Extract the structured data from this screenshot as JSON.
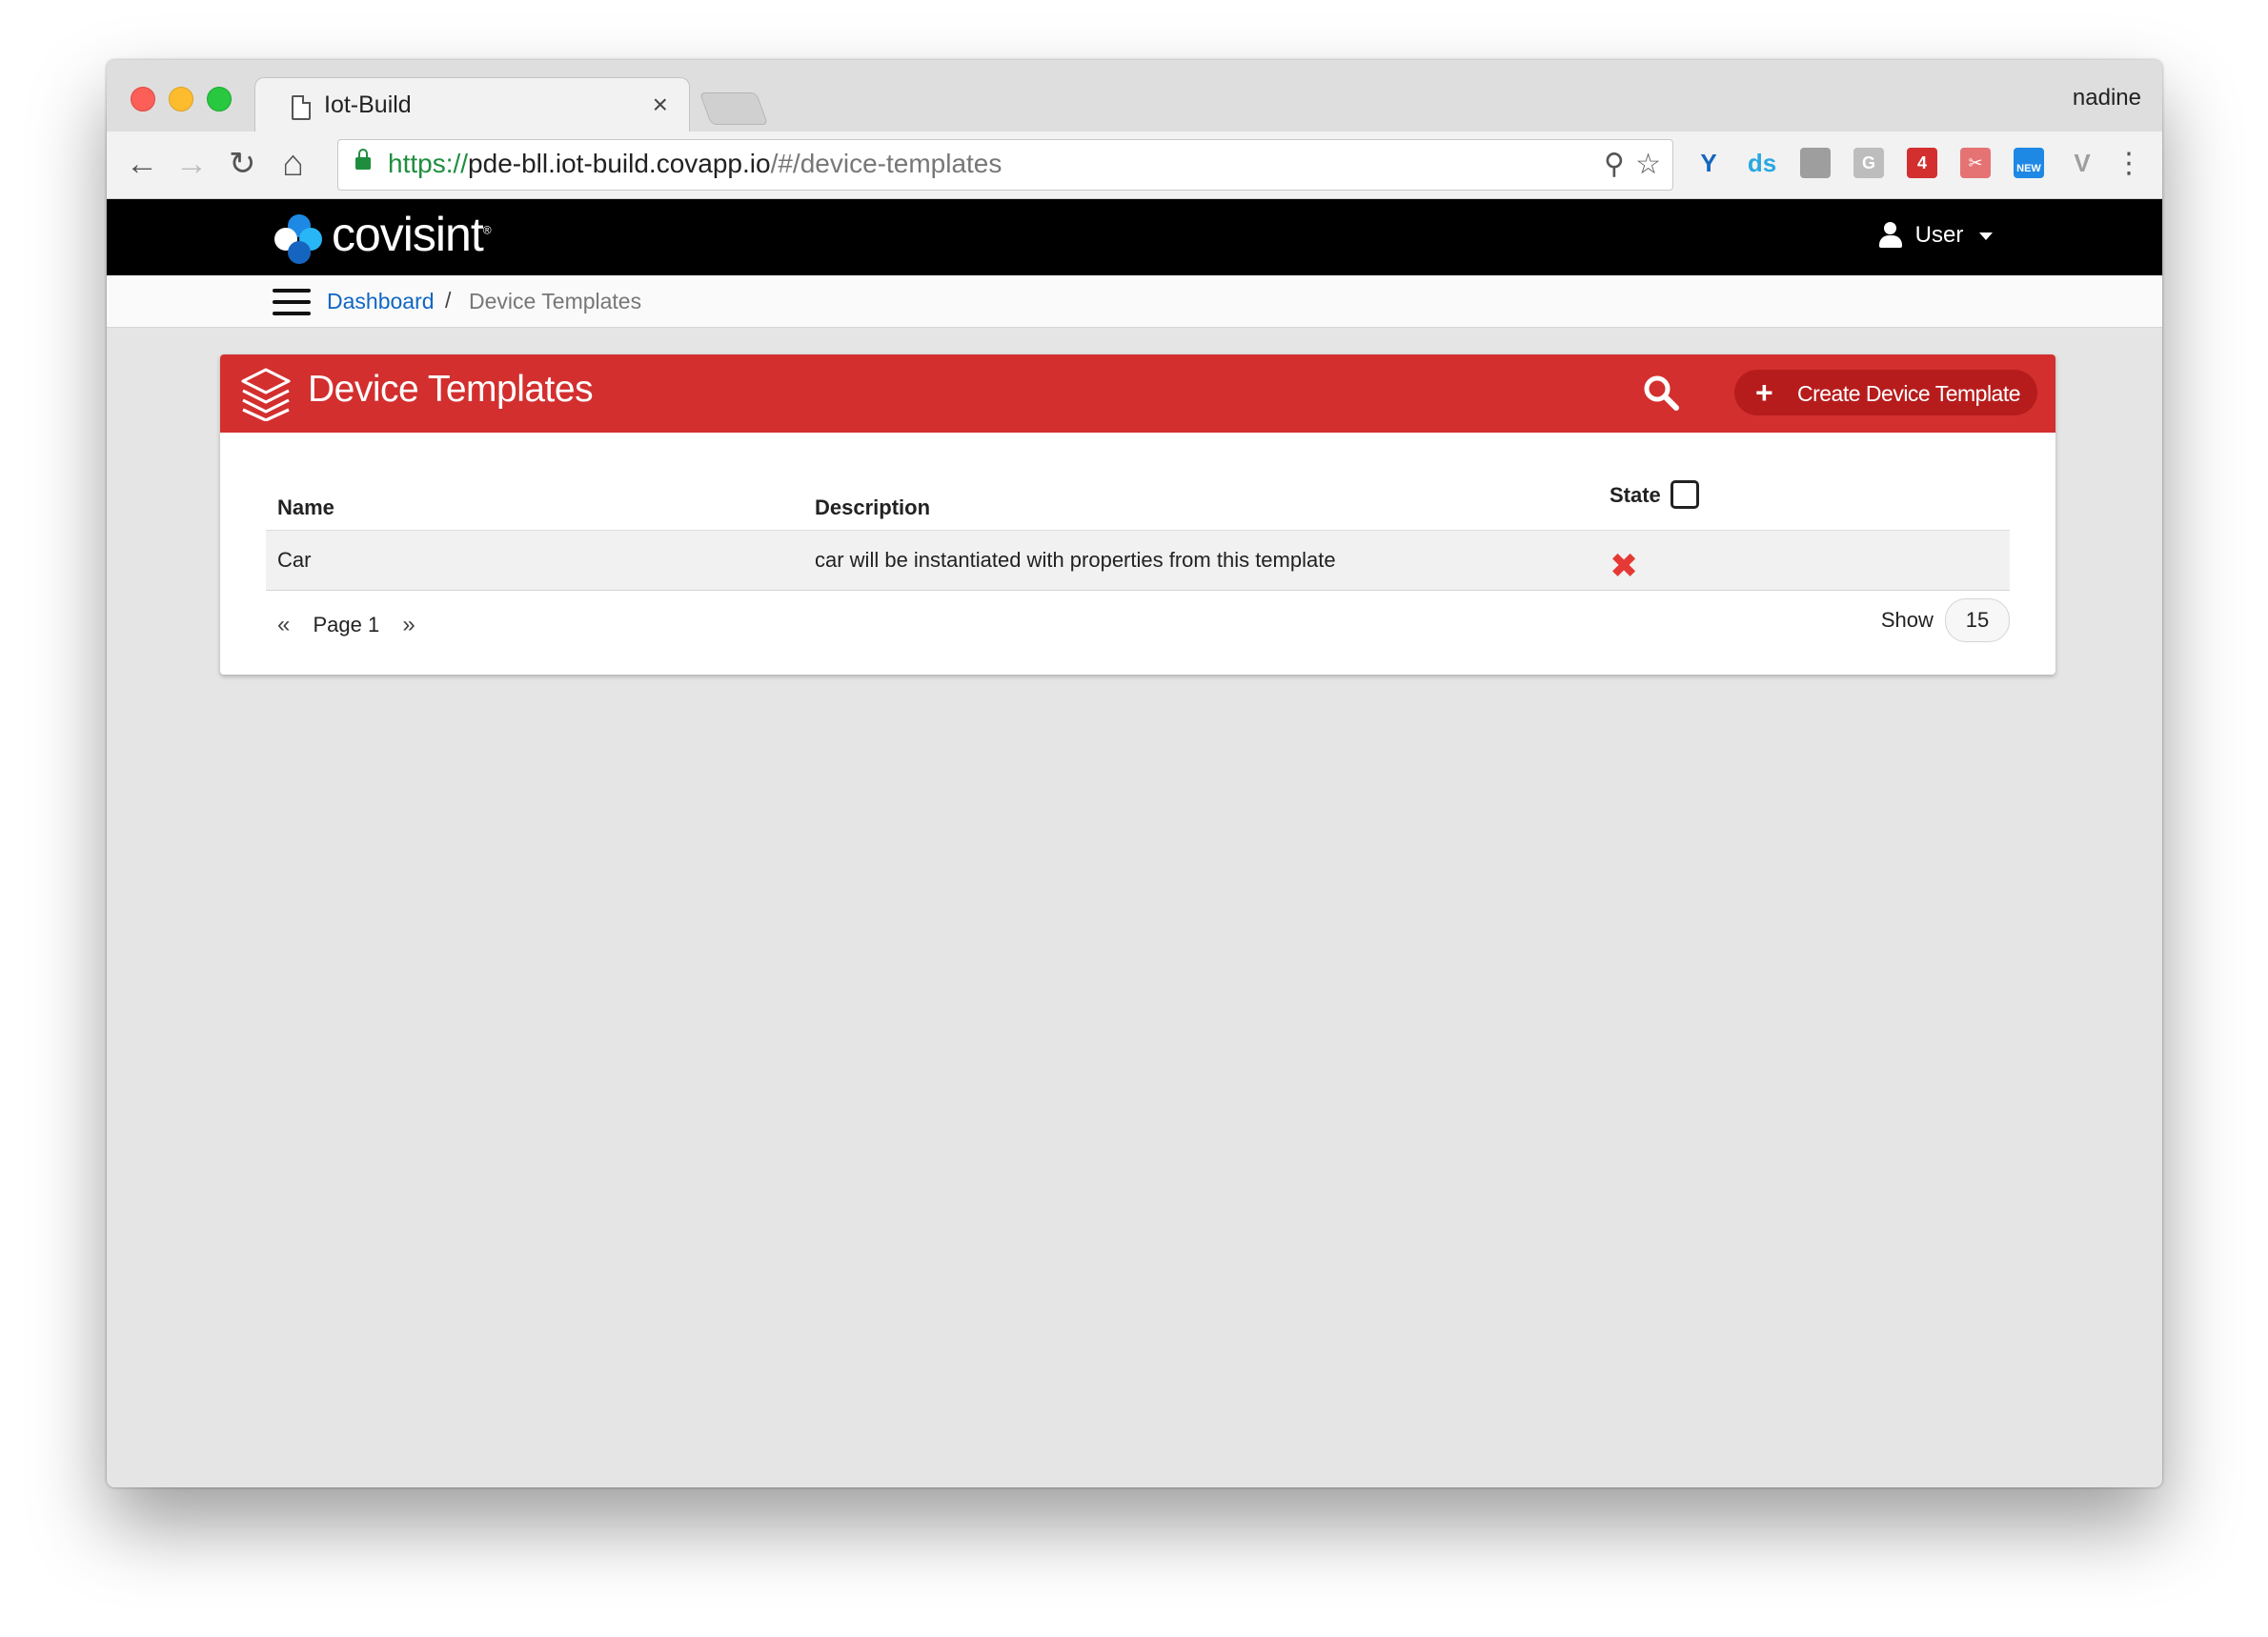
{
  "browser": {
    "tab_title": "Iot-Build",
    "tab_close": "×",
    "profile_name": "nadine",
    "url": {
      "scheme": "https://",
      "host": "pde-bll.iot-build.covapp.io",
      "path": "/#/device-templates"
    },
    "nav": {
      "back": "←",
      "forward": "→",
      "reload": "↻",
      "home": "⌂"
    },
    "omnibox_icons": {
      "zoom": "⚲",
      "bookmark": "☆"
    },
    "extensions": [
      {
        "name": "y-extension-icon",
        "label": "Y",
        "color": "#1565c0"
      },
      {
        "name": "ds-extension-icon",
        "label": "ds",
        "color": "#29a8e0"
      },
      {
        "name": "shield-extension-icon",
        "label": "",
        "color": "#9e9e9e"
      },
      {
        "name": "g-extension-icon",
        "label": "G",
        "color": "#bdbdbd"
      },
      {
        "name": "calendar-extension-icon",
        "label": "4",
        "color": "#d32f2f"
      },
      {
        "name": "scissors-extension-icon",
        "label": "✂",
        "color": "#e57373"
      },
      {
        "name": "new-extension-icon",
        "label": "NEW",
        "color": "#1e88e5"
      },
      {
        "name": "v-extension-icon",
        "label": "V",
        "color": "#9e9e9e"
      }
    ],
    "menu": "⋮"
  },
  "app": {
    "logo_text": "covisint",
    "logo_colors": [
      "#1e88e5",
      "#ffffff",
      "#29b6f6",
      "#1565c0"
    ],
    "user_label": "User"
  },
  "breadcrumb": {
    "dashboard": "Dashboard",
    "separator": "/",
    "current": "Device Templates"
  },
  "panel": {
    "title": "Device Templates",
    "create_button": "Create Device Template",
    "create_plus": "+",
    "accent_color": "#d32f2f",
    "columns": {
      "name": "Name",
      "description": "Description",
      "state": "State"
    },
    "rows": [
      {
        "name": "Car",
        "description": "car will be instantiated with properties from this template",
        "state_icon": "✖"
      }
    ],
    "pager": {
      "prev": "«",
      "label": "Page 1",
      "next": "»"
    },
    "show_label": "Show",
    "page_size": "15"
  }
}
